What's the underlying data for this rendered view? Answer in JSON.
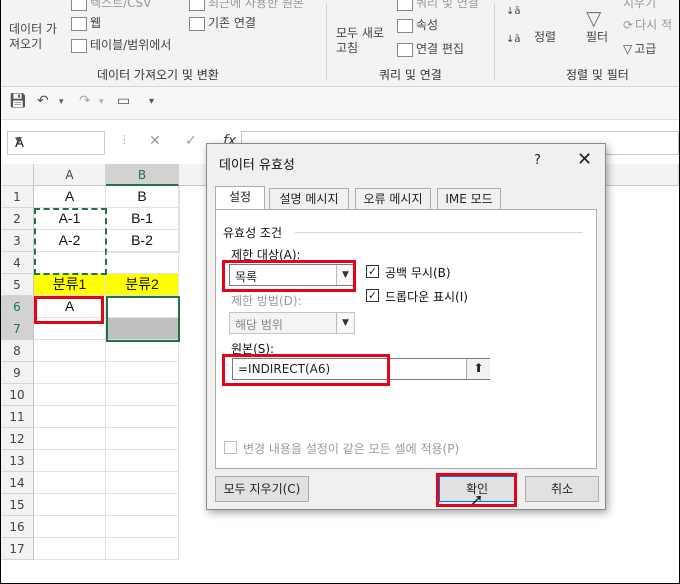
{
  "ribbon": {
    "data_get": "데이터 가\n져오기",
    "text_csv": "텍스트/CSV",
    "web": "웹",
    "table_range": "테이블/범위에서",
    "recent_sources": "최근에 사용한 원본",
    "existing_connections": "기존 연결",
    "group_get_transform": "데이터 가져오기 및 변환",
    "refresh_all": "모두 새로\n고침",
    "queries_connections": "쿼리 및 연결",
    "properties": "속성",
    "edit_links": "연결 편집",
    "group_queries": "쿼리 및 연결",
    "sort": "정렬",
    "filter": "필터",
    "clear": "지우기",
    "reapply": "다시 적",
    "advanced": "고급",
    "group_sort_filter": "정렬 및 필터"
  },
  "formula_bar": {
    "name_box": "A",
    "fx": "fx"
  },
  "columns": [
    "A",
    "B"
  ],
  "rows": [
    "1",
    "2",
    "3",
    "4",
    "5",
    "6",
    "7",
    "8",
    "9",
    "10",
    "11",
    "12",
    "13",
    "14",
    "15",
    "16",
    "17"
  ],
  "cells": {
    "A1": "A",
    "B1": "B",
    "A2": "A-1",
    "B2": "B-1",
    "A3": "A-2",
    "B3": "B-2",
    "A5": "분류1",
    "B5": "분류2",
    "A6": "A"
  },
  "colors": {
    "accent_green": "#217346",
    "highlight_red": "#e3061a",
    "header_yellow": "#ffff00"
  },
  "dialog": {
    "title": "데이터 유효성",
    "help": "?",
    "close": "✕",
    "tabs": [
      "설정",
      "설명 메시지",
      "오류 메시지",
      "IME 모드"
    ],
    "section": "유효성 조건",
    "allow_label": "제한 대상(A):",
    "allow_value": "목록",
    "ignore_blank": "공백 무시(B)",
    "dropdown": "드롭다운 표시(I)",
    "data_label": "제한 방법(D):",
    "data_value": "해당 범위",
    "source_label": "원본(S):",
    "source_value": "=INDIRECT(A6)",
    "apply_all": "변경 내용을 설정이 같은 모든 셀에 적용(P)",
    "clear_all": "모두 지우기(C)",
    "ok": "확인",
    "cancel": "취소"
  }
}
